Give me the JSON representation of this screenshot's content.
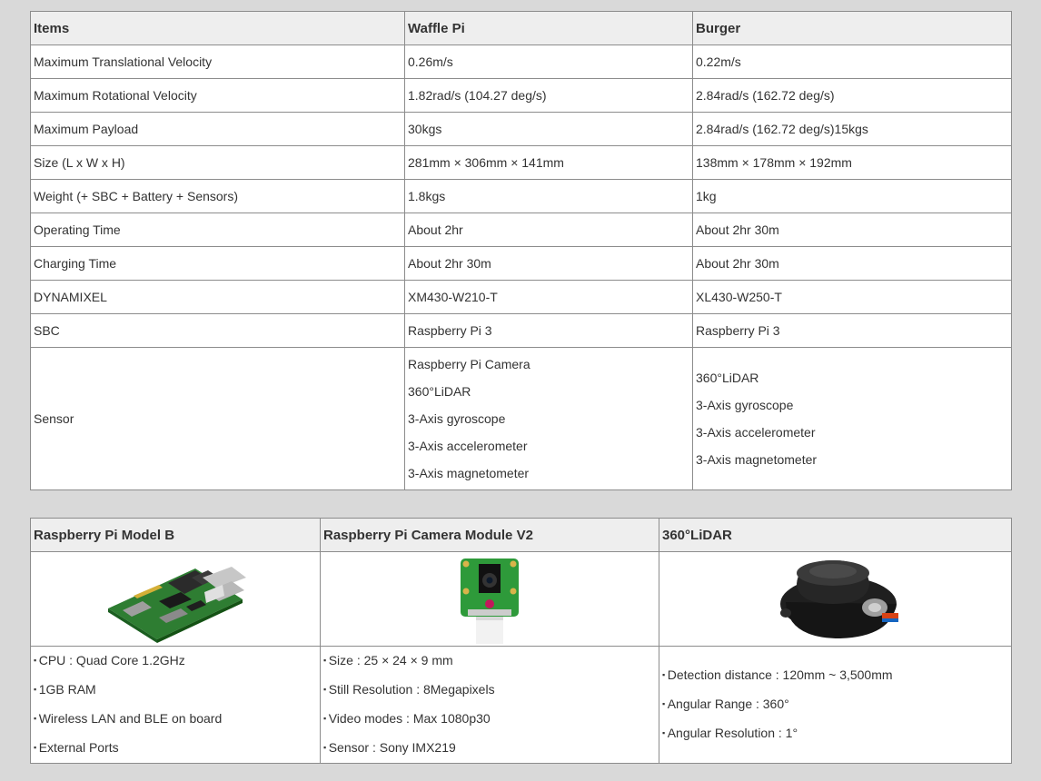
{
  "spec_table": {
    "headers": [
      "Items",
      "Waffle Pi",
      "Burger"
    ],
    "rows": [
      [
        "Maximum Translational Velocity",
        "0.26m/s",
        "0.22m/s"
      ],
      [
        "Maximum Rotational Velocity",
        "1.82rad/s (104.27 deg/s)",
        "2.84rad/s (162.72 deg/s)"
      ],
      [
        "Maximum Payload",
        "30kgs",
        "2.84rad/s (162.72 deg/s)15kgs"
      ],
      [
        "Size (L x W x H)",
        "281mm × 306mm × 141mm",
        "138mm × 178mm × 192mm"
      ],
      [
        "Weight (+ SBC + Battery + Sensors)",
        "1.8kgs",
        "1kg"
      ],
      [
        "Operating Time",
        "About 2hr",
        "About 2hr 30m"
      ],
      [
        "Charging Time",
        "About 2hr 30m",
        "About 2hr 30m"
      ],
      [
        "DYNAMIXEL",
        "XM430-W210-T",
        "XL430-W250-T"
      ],
      [
        "SBC",
        "Raspberry Pi 3",
        "Raspberry Pi 3"
      ]
    ],
    "sensor": {
      "label": "Sensor",
      "waffle": [
        "Raspberry Pi Camera",
        "360°LiDAR",
        "3-Axis gyroscope",
        "3-Axis accelerometer",
        "3-Axis magnetometer"
      ],
      "burger": [
        "360°LiDAR",
        "3-Axis gyroscope",
        "3-Axis accelerometer",
        "3-Axis magnetometer"
      ]
    }
  },
  "parts_table": {
    "headers": [
      "Raspberry Pi Model B",
      "Raspberry Pi Camera Module V2",
      "360°LiDAR"
    ],
    "images": [
      "raspberry-pi-board-image",
      "camera-module-image",
      "lidar-image"
    ],
    "features": [
      [
        "CPU : Quad Core 1.2GHz",
        "1GB RAM",
        "Wireless LAN and BLE on board",
        "External Ports"
      ],
      [
        "Size : 25 × 24 × 9 mm",
        "Still Resolution : 8Megapixels",
        "Video modes : Max 1080p30",
        "Sensor : Sony IMX219"
      ],
      [
        "Detection distance : 120mm ~ 3,500mm",
        "Angular Range : 360°",
        "Angular Resolution : 1°"
      ]
    ]
  }
}
